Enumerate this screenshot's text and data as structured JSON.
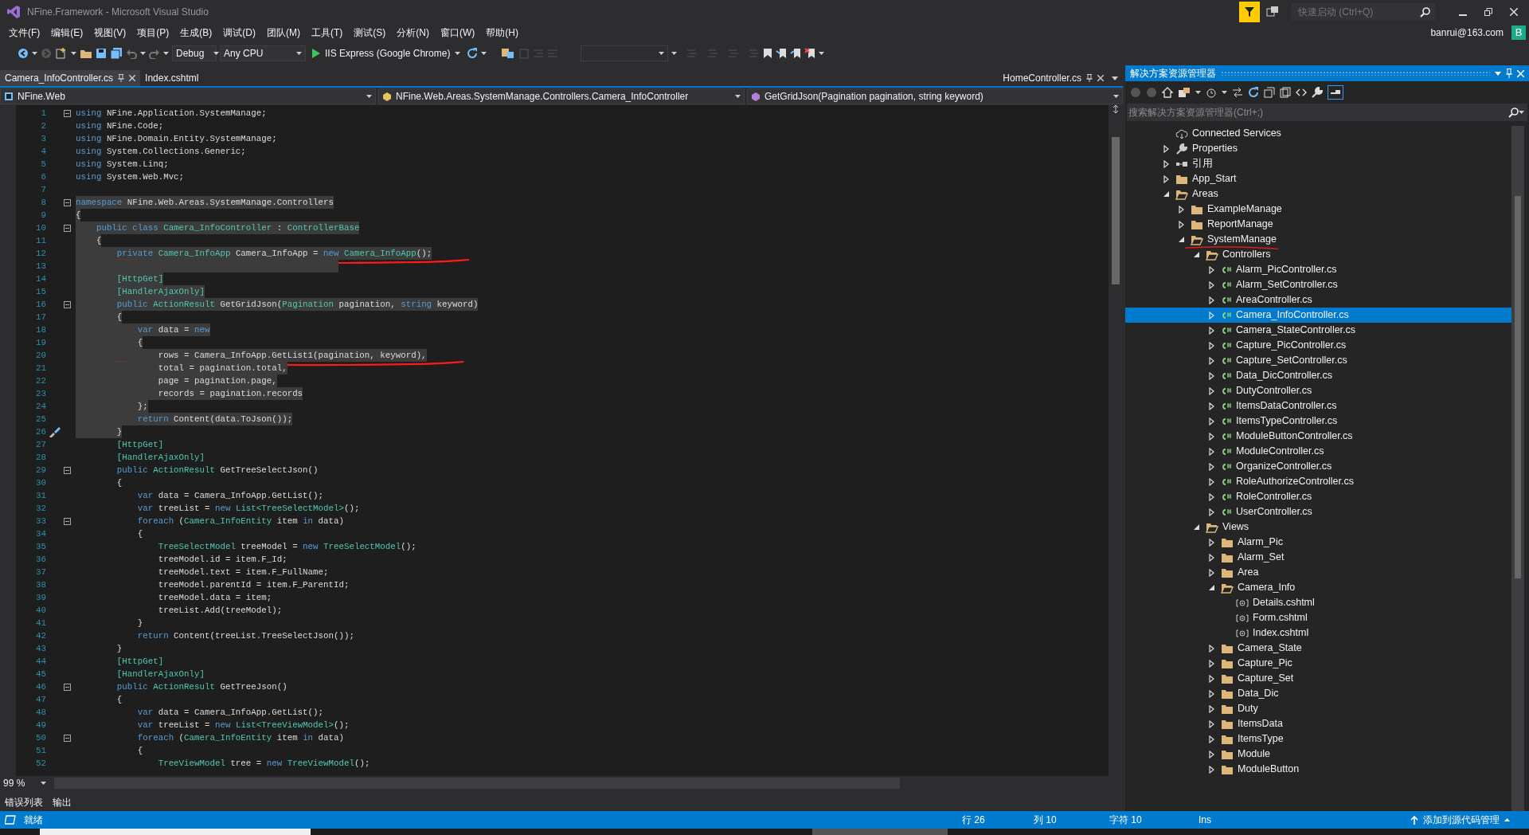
{
  "window": {
    "title": "NFine.Framework - Microsoft Visual Studio",
    "quick_launch": {
      "placeholder": "快速启动 (Ctrl+Q)"
    }
  },
  "menu": [
    "文件(F)",
    "编辑(E)",
    "视图(V)",
    "项目(P)",
    "生成(B)",
    "调试(D)",
    "团队(M)",
    "工具(T)",
    "测试(S)",
    "分析(N)",
    "窗口(W)",
    "帮助(H)"
  ],
  "account": {
    "user": "banrui@163.com",
    "avatar": "B"
  },
  "toolbar": {
    "configuration": "Debug",
    "platform": "Any CPU",
    "run_target": "IIS Express (Google Chrome)"
  },
  "editor": {
    "tabs": [
      {
        "label": "Camera_InfoController.cs",
        "selected": true,
        "closable": true
      },
      {
        "label": "Index.cshtml",
        "selected": false,
        "closable": false
      }
    ],
    "right_tabs": [
      {
        "label": "HomeController.cs",
        "selected": false,
        "closable": true
      }
    ],
    "nav": {
      "project": "NFine.Web",
      "type": "NFine.Web.Areas.SystemManage.Controllers.Camera_InfoController",
      "member": "GetGridJson(Pagination pagination, string keyword)"
    },
    "lines": [
      {
        "num": "1",
        "foldable": true,
        "selected": false,
        "tokens": [
          {
            "kind": "keyword",
            "text": "using"
          },
          {
            "kind": "text",
            "text": " NFine.Application.SystemManage;"
          }
        ]
      },
      {
        "num": "2",
        "foldable": false,
        "selected": false,
        "tokens": [
          {
            "kind": "keyword",
            "text": "using"
          },
          {
            "kind": "text",
            "text": " NFine.Code;"
          }
        ]
      },
      {
        "num": "3",
        "foldable": false,
        "selected": false,
        "tokens": [
          {
            "kind": "keyword",
            "text": "using"
          },
          {
            "kind": "text",
            "text": " NFine.Domain.Entity.SystemManage;"
          }
        ]
      },
      {
        "num": "4",
        "foldable": false,
        "selected": false,
        "tokens": [
          {
            "kind": "keyword",
            "text": "using"
          },
          {
            "kind": "text",
            "text": " System.Collections.Generic;"
          }
        ]
      },
      {
        "num": "5",
        "foldable": false,
        "selected": false,
        "tokens": [
          {
            "kind": "keyword",
            "text": "using"
          },
          {
            "kind": "text",
            "text": " System.Linq;"
          }
        ]
      },
      {
        "num": "6",
        "foldable": false,
        "selected": false,
        "tokens": [
          {
            "kind": "keyword",
            "text": "using"
          },
          {
            "kind": "text",
            "text": " System.Web.Mvc;"
          }
        ]
      },
      {
        "num": "7",
        "foldable": false,
        "selected": false
      },
      {
        "num": "8",
        "foldable": true,
        "selected": true,
        "tokens": [
          {
            "kind": "keyword",
            "text": "namespace"
          },
          {
            "kind": "text",
            "text": " NFine.Web.Areas.SystemManage.Controllers"
          }
        ]
      },
      {
        "num": "9",
        "foldable": false,
        "selected": true,
        "tokens": [
          {
            "kind": "text",
            "text": "{"
          }
        ]
      },
      {
        "num": "10",
        "foldable": true,
        "selected": true,
        "tokens": [
          {
            "kind": "keyword",
            "text": "    public"
          },
          {
            "kind": "keyword",
            "text": " class"
          },
          {
            "kind": "type",
            "text": " Camera_InfoController"
          },
          {
            "kind": "text",
            "text": " : "
          },
          {
            "kind": "type",
            "text": "ControllerBase"
          }
        ]
      },
      {
        "num": "11",
        "foldable": false,
        "selected": true,
        "tokens": [
          {
            "kind": "text",
            "text": "    {"
          }
        ]
      },
      {
        "num": "12",
        "foldable": false,
        "selected": true,
        "underlined": true,
        "tokens": [
          {
            "kind": "keyword",
            "text": "        private"
          },
          {
            "kind": "type",
            "text": " Camera_InfoApp"
          },
          {
            "kind": "text",
            "text": " Camera_InfoApp = "
          },
          {
            "kind": "keyword",
            "text": "new"
          },
          {
            "kind": "type",
            "text": " Camera_InfoApp"
          },
          {
            "kind": "text",
            "text": "();"
          }
        ]
      },
      {
        "num": "13",
        "foldable": false,
        "selected": true
      },
      {
        "num": "14",
        "foldable": false,
        "selected": true,
        "tokens": [
          {
            "kind": "type",
            "text": "        [HttpGet]"
          }
        ]
      },
      {
        "num": "15",
        "foldable": false,
        "selected": true,
        "tokens": [
          {
            "kind": "type",
            "text": "        [HandlerAjaxOnly]"
          }
        ]
      },
      {
        "num": "16",
        "foldable": true,
        "selected": true,
        "tokens": [
          {
            "kind": "keyword",
            "text": "        public"
          },
          {
            "kind": "type",
            "text": " ActionResult"
          },
          {
            "kind": "text",
            "text": " GetGridJson("
          },
          {
            "kind": "type",
            "text": "Pagination"
          },
          {
            "kind": "text",
            "text": " pagination, "
          },
          {
            "kind": "keyword",
            "text": "string"
          },
          {
            "kind": "text",
            "text": " keyword)"
          }
        ]
      },
      {
        "num": "17",
        "foldable": false,
        "selected": true,
        "tokens": [
          {
            "kind": "text",
            "text": "        {"
          }
        ]
      },
      {
        "num": "18",
        "foldable": false,
        "selected": true,
        "tokens": [
          {
            "kind": "keyword",
            "text": "            var"
          },
          {
            "kind": "text",
            "text": " data = "
          },
          {
            "kind": "keyword",
            "text": "new"
          }
        ]
      },
      {
        "num": "19",
        "foldable": false,
        "selected": true,
        "tokens": [
          {
            "kind": "text",
            "text": "            {"
          }
        ]
      },
      {
        "num": "20",
        "foldable": false,
        "selected": true,
        "underlined": true,
        "tokens": [
          {
            "kind": "text",
            "text": "                rows = Camera_InfoApp.GetList1(pagination, keyword),"
          }
        ]
      },
      {
        "num": "21",
        "foldable": false,
        "selected": true,
        "tokens": [
          {
            "kind": "text",
            "text": "                total = pagination.total,"
          }
        ]
      },
      {
        "num": "22",
        "foldable": false,
        "selected": true,
        "tokens": [
          {
            "kind": "text",
            "text": "                page = pagination.page,"
          }
        ]
      },
      {
        "num": "23",
        "foldable": false,
        "selected": true,
        "tokens": [
          {
            "kind": "text",
            "text": "                records = pagination.records"
          }
        ]
      },
      {
        "num": "24",
        "foldable": false,
        "selected": true,
        "tokens": [
          {
            "kind": "text",
            "text": "            };"
          }
        ]
      },
      {
        "num": "25",
        "foldable": false,
        "selected": true,
        "tokens": [
          {
            "kind": "keyword",
            "text": "            return"
          },
          {
            "kind": "text",
            "text": " Content(data.ToJson());"
          }
        ]
      },
      {
        "num": "26",
        "foldable": false,
        "selected": true,
        "quick_action": true,
        "tokens": [
          {
            "kind": "text",
            "text": "        }"
          }
        ]
      },
      {
        "num": "27",
        "foldable": false,
        "selected": false,
        "tokens": [
          {
            "kind": "type",
            "text": "        [HttpGet]"
          }
        ]
      },
      {
        "num": "28",
        "foldable": false,
        "selected": false,
        "tokens": [
          {
            "kind": "type",
            "text": "        [HandlerAjaxOnly]"
          }
        ]
      },
      {
        "num": "29",
        "foldable": true,
        "selected": false,
        "tokens": [
          {
            "kind": "keyword",
            "text": "        public"
          },
          {
            "kind": "type",
            "text": " ActionResult"
          },
          {
            "kind": "text",
            "text": " GetTreeSelectJson()"
          }
        ]
      },
      {
        "num": "30",
        "foldable": false,
        "selected": false,
        "tokens": [
          {
            "kind": "text",
            "text": "        {"
          }
        ]
      },
      {
        "num": "31",
        "foldable": false,
        "selected": false,
        "tokens": [
          {
            "kind": "keyword",
            "text": "            var"
          },
          {
            "kind": "text",
            "text": " data = Camera_InfoApp.GetList();"
          }
        ]
      },
      {
        "num": "32",
        "foldable": false,
        "selected": false,
        "tokens": [
          {
            "kind": "keyword",
            "text": "            var"
          },
          {
            "kind": "text",
            "text": " treeList = "
          },
          {
            "kind": "keyword",
            "text": "new"
          },
          {
            "kind": "type",
            "text": " List<TreeSelectModel>"
          },
          {
            "kind": "text",
            "text": "();"
          }
        ]
      },
      {
        "num": "33",
        "foldable": true,
        "selected": false,
        "tokens": [
          {
            "kind": "keyword",
            "text": "            foreach"
          },
          {
            "kind": "text",
            "text": " ("
          },
          {
            "kind": "type",
            "text": "Camera_InfoEntity"
          },
          {
            "kind": "text",
            "text": " item "
          },
          {
            "kind": "keyword",
            "text": "in"
          },
          {
            "kind": "text",
            "text": " data)"
          }
        ]
      },
      {
        "num": "34",
        "foldable": false,
        "selected": false,
        "tokens": [
          {
            "kind": "text",
            "text": "            {"
          }
        ]
      },
      {
        "num": "35",
        "foldable": false,
        "selected": false,
        "tokens": [
          {
            "kind": "type",
            "text": "                TreeSelectModel"
          },
          {
            "kind": "text",
            "text": " treeModel = "
          },
          {
            "kind": "keyword",
            "text": "new"
          },
          {
            "kind": "type",
            "text": " TreeSelectModel"
          },
          {
            "kind": "text",
            "text": "();"
          }
        ]
      },
      {
        "num": "36",
        "foldable": false,
        "selected": false,
        "tokens": [
          {
            "kind": "text",
            "text": "                treeModel.id = item.F_Id;"
          }
        ]
      },
      {
        "num": "37",
        "foldable": false,
        "selected": false,
        "tokens": [
          {
            "kind": "text",
            "text": "                treeModel.text = item.F_FullName;"
          }
        ]
      },
      {
        "num": "38",
        "foldable": false,
        "selected": false,
        "tokens": [
          {
            "kind": "text",
            "text": "                treeModel.parentId = item.F_ParentId;"
          }
        ]
      },
      {
        "num": "39",
        "foldable": false,
        "selected": false,
        "tokens": [
          {
            "kind": "text",
            "text": "                treeModel.data = item;"
          }
        ]
      },
      {
        "num": "40",
        "foldable": false,
        "selected": false,
        "tokens": [
          {
            "kind": "text",
            "text": "                treeList.Add(treeModel);"
          }
        ]
      },
      {
        "num": "41",
        "foldable": false,
        "selected": false,
        "tokens": [
          {
            "kind": "text",
            "text": "            }"
          }
        ]
      },
      {
        "num": "42",
        "foldable": false,
        "selected": false,
        "tokens": [
          {
            "kind": "keyword",
            "text": "            return"
          },
          {
            "kind": "text",
            "text": " Content(treeList.TreeSelectJson());"
          }
        ]
      },
      {
        "num": "43",
        "foldable": false,
        "selected": false,
        "tokens": [
          {
            "kind": "text",
            "text": "        }"
          }
        ]
      },
      {
        "num": "44",
        "foldable": false,
        "selected": false,
        "tokens": [
          {
            "kind": "type",
            "text": "        [HttpGet]"
          }
        ]
      },
      {
        "num": "45",
        "foldable": false,
        "selected": false,
        "tokens": [
          {
            "kind": "type",
            "text": "        [HandlerAjaxOnly]"
          }
        ]
      },
      {
        "num": "46",
        "foldable": true,
        "selected": false,
        "tokens": [
          {
            "kind": "keyword",
            "text": "        public"
          },
          {
            "kind": "type",
            "text": " ActionResult"
          },
          {
            "kind": "text",
            "text": " GetTreeJson()"
          }
        ]
      },
      {
        "num": "47",
        "foldable": false,
        "selected": false,
        "tokens": [
          {
            "kind": "text",
            "text": "        {"
          }
        ]
      },
      {
        "num": "48",
        "foldable": false,
        "selected": false,
        "tokens": [
          {
            "kind": "keyword",
            "text": "            var"
          },
          {
            "kind": "text",
            "text": " data = Camera_InfoApp.GetList();"
          }
        ]
      },
      {
        "num": "49",
        "foldable": false,
        "selected": false,
        "tokens": [
          {
            "kind": "keyword",
            "text": "            var"
          },
          {
            "kind": "text",
            "text": " treeList = "
          },
          {
            "kind": "keyword",
            "text": "new"
          },
          {
            "kind": "type",
            "text": " List<TreeViewModel>"
          },
          {
            "kind": "text",
            "text": "();"
          }
        ]
      },
      {
        "num": "50",
        "foldable": true,
        "selected": false,
        "tokens": [
          {
            "kind": "keyword",
            "text": "            foreach"
          },
          {
            "kind": "text",
            "text": " ("
          },
          {
            "kind": "type",
            "text": "Camera_InfoEntity"
          },
          {
            "kind": "text",
            "text": " item "
          },
          {
            "kind": "keyword",
            "text": "in"
          },
          {
            "kind": "text",
            "text": " data)"
          }
        ]
      },
      {
        "num": "51",
        "foldable": false,
        "selected": false,
        "tokens": [
          {
            "kind": "text",
            "text": "            {"
          }
        ]
      },
      {
        "num": "52",
        "foldable": false,
        "selected": false,
        "tokens": [
          {
            "kind": "type",
            "text": "                TreeViewModel"
          },
          {
            "kind": "text",
            "text": " tree = "
          },
          {
            "kind": "keyword",
            "text": "new"
          },
          {
            "kind": "type",
            "text": " TreeViewModel"
          },
          {
            "kind": "text",
            "text": "();"
          }
        ]
      }
    ],
    "zoom": "99 %"
  },
  "solution_explorer": {
    "title": "解决方案资源管理器",
    "search": {
      "placeholder": "搜索解决方案资源管理器(Ctrl+;)"
    },
    "items": [
      {
        "label": "Connected Services",
        "kind": "connected",
        "selected": false
      },
      {
        "label": "Properties",
        "kind": "properties",
        "expanded": false,
        "selected": false
      },
      {
        "label": "引用",
        "kind": "references",
        "expanded": false,
        "selected": false
      },
      {
        "label": "App_Start",
        "kind": "folder",
        "expanded": false,
        "selected": false
      },
      {
        "label": "Areas",
        "kind": "folder",
        "expanded": true,
        "selected": false,
        "children": [
          {
            "label": "ExampleManage",
            "kind": "folder",
            "expanded": false,
            "selected": false
          },
          {
            "label": "ReportManage",
            "kind": "folder",
            "expanded": false,
            "selected": false
          },
          {
            "label": "SystemManage",
            "kind": "folder",
            "expanded": true,
            "selected": false,
            "underlined": true,
            "children": [
              {
                "label": "Controllers",
                "kind": "folder",
                "expanded": true,
                "selected": false,
                "children": [
                  {
                    "label": "Alarm_PicController.cs",
                    "kind": "csharp",
                    "expanded": false,
                    "selected": false
                  },
                  {
                    "label": "Alarm_SetController.cs",
                    "kind": "csharp",
                    "expanded": false,
                    "selected": false
                  },
                  {
                    "label": "AreaController.cs",
                    "kind": "csharp",
                    "expanded": false,
                    "selected": false
                  },
                  {
                    "label": "Camera_InfoController.cs",
                    "kind": "csharp",
                    "expanded": false,
                    "selected": true
                  },
                  {
                    "label": "Camera_StateController.cs",
                    "kind": "csharp",
                    "expanded": false,
                    "selected": false
                  },
                  {
                    "label": "Capture_PicController.cs",
                    "kind": "csharp",
                    "expanded": false,
                    "selected": false
                  },
                  {
                    "label": "Capture_SetController.cs",
                    "kind": "csharp",
                    "expanded": false,
                    "selected": false
                  },
                  {
                    "label": "Data_DicController.cs",
                    "kind": "csharp",
                    "expanded": false,
                    "selected": false
                  },
                  {
                    "label": "DutyController.cs",
                    "kind": "csharp",
                    "expanded": false,
                    "selected": false
                  },
                  {
                    "label": "ItemsDataController.cs",
                    "kind": "csharp",
                    "expanded": false,
                    "selected": false
                  },
                  {
                    "label": "ItemsTypeController.cs",
                    "kind": "csharp",
                    "expanded": false,
                    "selected": false
                  },
                  {
                    "label": "ModuleButtonController.cs",
                    "kind": "csharp",
                    "expanded": false,
                    "selected": false
                  },
                  {
                    "label": "ModuleController.cs",
                    "kind": "csharp",
                    "expanded": false,
                    "selected": false
                  },
                  {
                    "label": "OrganizeController.cs",
                    "kind": "csharp",
                    "expanded": false,
                    "selected": false
                  },
                  {
                    "label": "RoleAuthorizeController.cs",
                    "kind": "csharp",
                    "expanded": false,
                    "selected": false
                  },
                  {
                    "label": "RoleController.cs",
                    "kind": "csharp",
                    "expanded": false,
                    "selected": false
                  },
                  {
                    "label": "UserController.cs",
                    "kind": "csharp",
                    "expanded": false,
                    "selected": false
                  }
                ]
              },
              {
                "label": "Views",
                "kind": "folder",
                "expanded": true,
                "selected": false,
                "children": [
                  {
                    "label": "Alarm_Pic",
                    "kind": "folder",
                    "expanded": false,
                    "selected": false
                  },
                  {
                    "label": "Alarm_Set",
                    "kind": "folder",
                    "expanded": false,
                    "selected": false
                  },
                  {
                    "label": "Area",
                    "kind": "folder",
                    "expanded": false,
                    "selected": false
                  },
                  {
                    "label": "Camera_Info",
                    "kind": "folder",
                    "expanded": true,
                    "selected": false,
                    "children": [
                      {
                        "label": "Details.cshtml",
                        "kind": "razor",
                        "selected": false
                      },
                      {
                        "label": "Form.cshtml",
                        "kind": "razor",
                        "selected": false
                      },
                      {
                        "label": "Index.cshtml",
                        "kind": "razor",
                        "selected": false
                      }
                    ]
                  },
                  {
                    "label": "Camera_State",
                    "kind": "folder",
                    "expanded": false,
                    "selected": false
                  },
                  {
                    "label": "Capture_Pic",
                    "kind": "folder",
                    "expanded": false,
                    "selected": false
                  },
                  {
                    "label": "Capture_Set",
                    "kind": "folder",
                    "expanded": false,
                    "selected": false
                  },
                  {
                    "label": "Data_Dic",
                    "kind": "folder",
                    "expanded": false,
                    "selected": false
                  },
                  {
                    "label": "Duty",
                    "kind": "folder",
                    "expanded": false,
                    "selected": false
                  },
                  {
                    "label": "ItemsData",
                    "kind": "folder",
                    "expanded": false,
                    "selected": false
                  },
                  {
                    "label": "ItemsType",
                    "kind": "folder",
                    "expanded": false,
                    "selected": false
                  },
                  {
                    "label": "Module",
                    "kind": "folder",
                    "expanded": false,
                    "selected": false
                  },
                  {
                    "label": "ModuleButton",
                    "kind": "folder",
                    "expanded": false,
                    "selected": false
                  }
                ]
              }
            ]
          }
        ]
      }
    ]
  },
  "bottom_tabs": [
    "错误列表",
    "输出"
  ],
  "status_bar": {
    "message": "就绪",
    "line": "行 26",
    "column": "列 10",
    "char": "字符 10",
    "mode": "Ins",
    "source_control": "添加到源代码管理"
  }
}
